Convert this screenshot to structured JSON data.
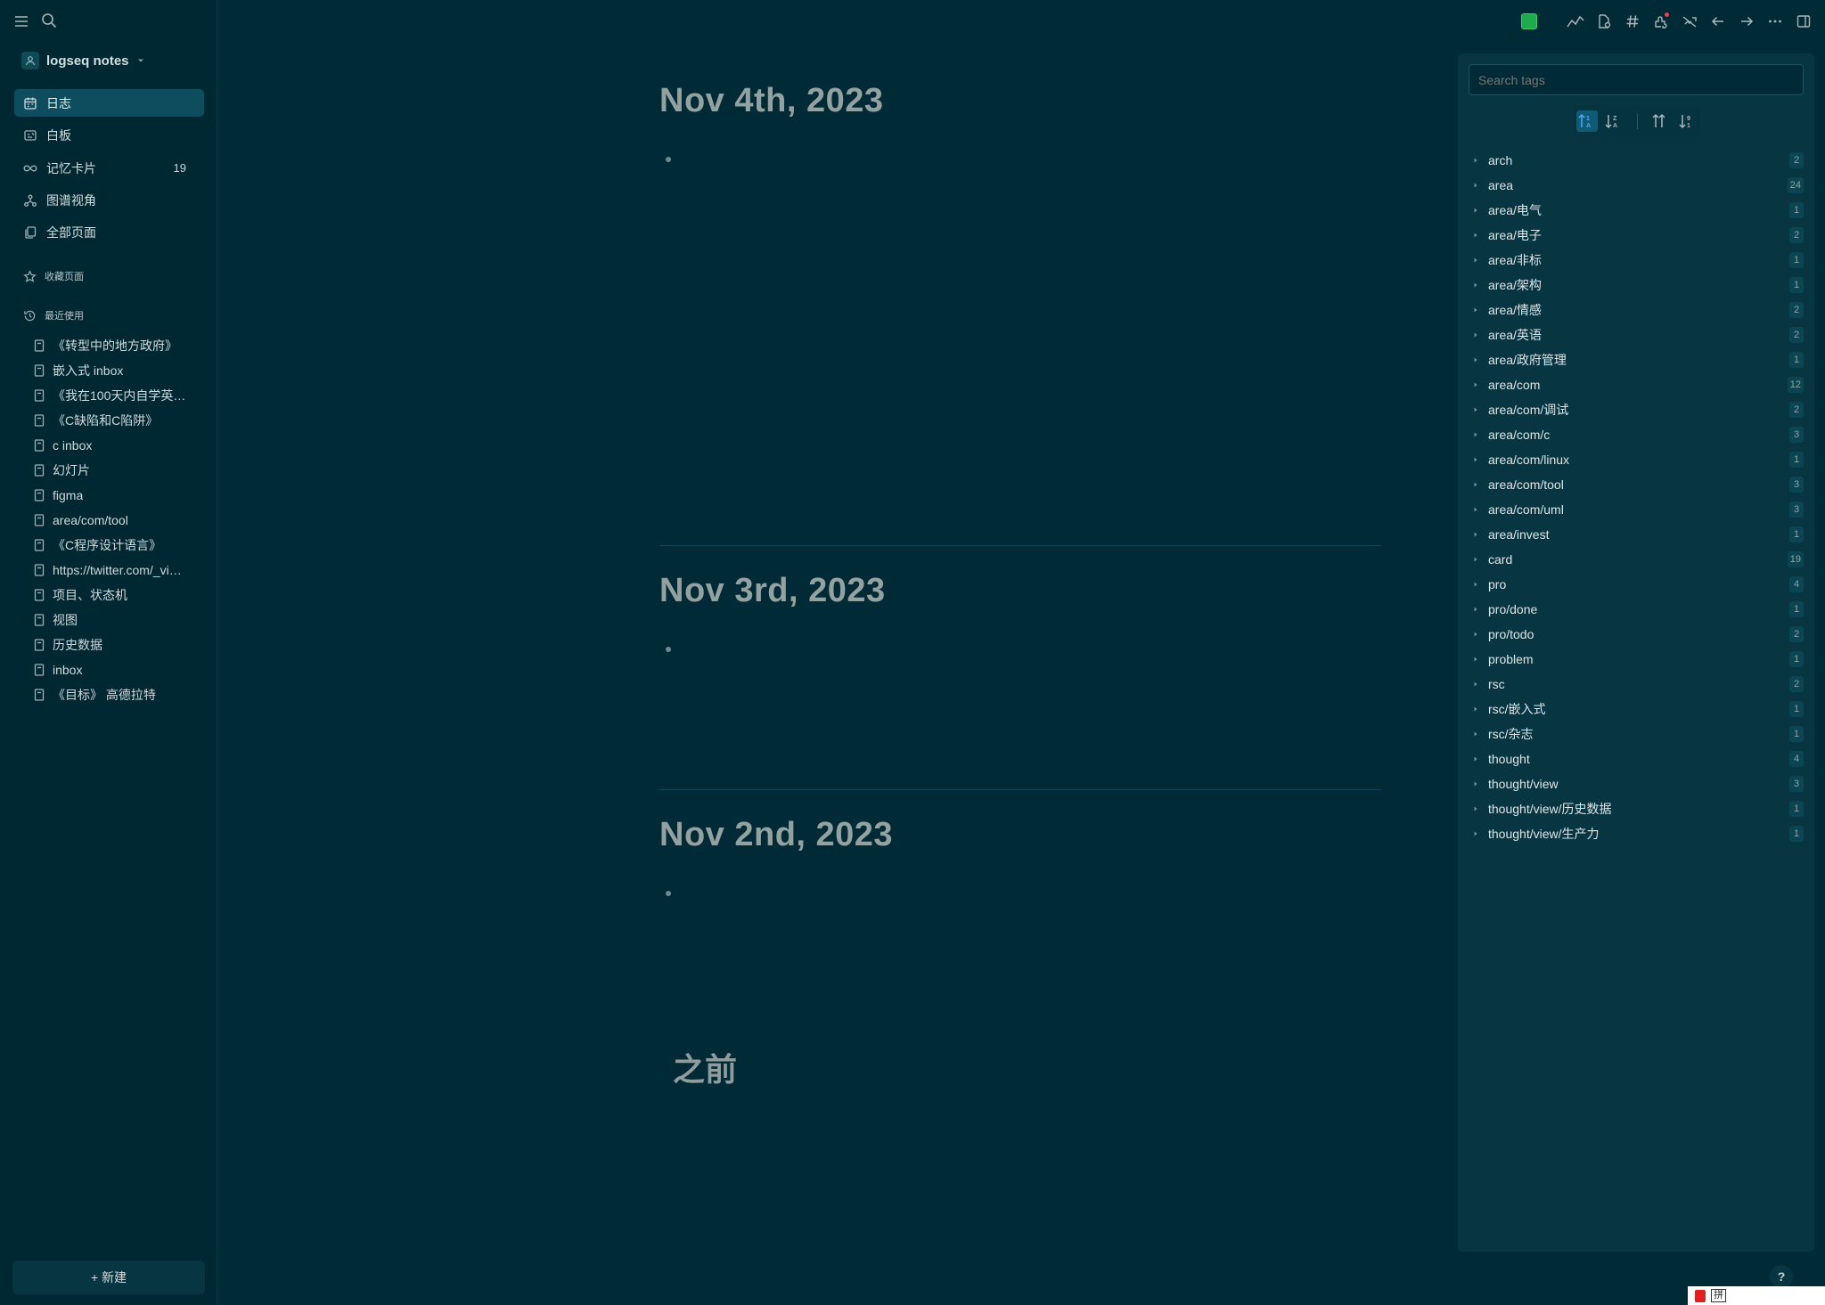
{
  "sidebar": {
    "graph_name": "logseq notes",
    "nav": [
      {
        "label": "日志",
        "icon": "calendar-icon"
      },
      {
        "label": "白板",
        "icon": "whiteboard-icon"
      },
      {
        "label": "记忆卡片",
        "icon": "infinity-icon",
        "count": "19"
      },
      {
        "label": "图谱视角",
        "icon": "graph-icon"
      },
      {
        "label": "全部页面",
        "icon": "pages-icon"
      }
    ],
    "favorites_label": "收藏页面",
    "recent_label": "最近使用",
    "recent": [
      "《转型中的地方政府》",
      "嵌入式 inbox",
      "《我在100天内自学英…",
      "《C缺陷和C陷阱》",
      "c inbox",
      "幻灯片",
      "figma",
      "area/com/tool",
      "《C程序设计语言》",
      "https://twitter.com/_vi…",
      "项目、状态机",
      "视图",
      "历史数据",
      "inbox",
      "《目标》 高德拉特"
    ],
    "new_button": "+ 新建"
  },
  "journals": [
    {
      "title": "Nov 4th, 2023"
    },
    {
      "title": "Nov 3rd, 2023"
    },
    {
      "title": "Nov 2nd, 2023"
    }
  ],
  "before_label": "之前",
  "tags_panel": {
    "search_placeholder": "Search tags",
    "tags": [
      {
        "name": "arch",
        "count": "2"
      },
      {
        "name": "area",
        "count": "24"
      },
      {
        "name": "area/电气",
        "count": "1"
      },
      {
        "name": "area/电子",
        "count": "2"
      },
      {
        "name": "area/非标",
        "count": "1"
      },
      {
        "name": "area/架构",
        "count": "1"
      },
      {
        "name": "area/情感",
        "count": "2"
      },
      {
        "name": "area/英语",
        "count": "2"
      },
      {
        "name": "area/政府管理",
        "count": "1"
      },
      {
        "name": "area/com",
        "count": "12"
      },
      {
        "name": "area/com/调试",
        "count": "2"
      },
      {
        "name": "area/com/c",
        "count": "3"
      },
      {
        "name": "area/com/linux",
        "count": "1"
      },
      {
        "name": "area/com/tool",
        "count": "3"
      },
      {
        "name": "area/com/uml",
        "count": "3"
      },
      {
        "name": "area/invest",
        "count": "1"
      },
      {
        "name": "card",
        "count": "19"
      },
      {
        "name": "pro",
        "count": "4"
      },
      {
        "name": "pro/done",
        "count": "1"
      },
      {
        "name": "pro/todo",
        "count": "2"
      },
      {
        "name": "problem",
        "count": "1"
      },
      {
        "name": "rsc",
        "count": "2"
      },
      {
        "name": "rsc/嵌入式",
        "count": "1"
      },
      {
        "name": "rsc/杂志",
        "count": "1"
      },
      {
        "name": "thought",
        "count": "4"
      },
      {
        "name": "thought/view",
        "count": "3"
      },
      {
        "name": "thought/view/历史数据",
        "count": "1"
      },
      {
        "name": "thought/view/生产力",
        "count": "1"
      }
    ]
  },
  "help_label": "?",
  "ime": {
    "mode": "拼"
  },
  "colors": {
    "background": "#002b36",
    "sidebar": "#002833",
    "active": "#0e4d5d",
    "panel": "#073642",
    "accent": "#4aa8ff"
  }
}
